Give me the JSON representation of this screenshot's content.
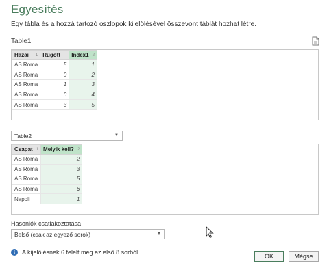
{
  "dialog": {
    "title": "Egyesítés",
    "subtitle": "Egy tábla és a hozzá tartozó oszlopok kijelölésével összevont táblát hozhat létre."
  },
  "table1": {
    "name": "Table1",
    "columns": [
      {
        "label": "Hazai",
        "index": "1",
        "selected": false
      },
      {
        "label": "Rúgott",
        "index": "",
        "selected": false
      },
      {
        "label": "Index1",
        "index": "2",
        "selected": true
      }
    ],
    "rows": [
      [
        "AS Roma",
        "5",
        "1"
      ],
      [
        "AS Roma",
        "0",
        "2"
      ],
      [
        "AS Roma",
        "1",
        "3"
      ],
      [
        "AS Roma",
        "0",
        "4"
      ],
      [
        "AS Roma",
        "3",
        "5"
      ]
    ]
  },
  "table2": {
    "selector_value": "Table2",
    "columns": [
      {
        "label": "Csapat",
        "index": "1",
        "selected": false
      },
      {
        "label": "Melyik kell?",
        "index": "2",
        "selected": true
      }
    ],
    "rows": [
      [
        "AS Roma",
        "2"
      ],
      [
        "AS Roma",
        "3"
      ],
      [
        "AS Roma",
        "5"
      ],
      [
        "AS Roma",
        "6"
      ],
      [
        "Napoli",
        "1"
      ]
    ]
  },
  "join": {
    "label": "Hasonlók csatlakoztatása",
    "value": "Belső (csak az egyező sorok)"
  },
  "info": {
    "icon": "info-icon",
    "text": "A kijelölésnek 6 felelt meg az első 8 sorból."
  },
  "buttons": {
    "ok": "OK",
    "cancel": "Mégse"
  },
  "colors": {
    "title": "#4a7d5d",
    "selected_header": "#bfe3c9",
    "selected_cells": "#e8f4ec",
    "info_icon": "#2f6db5"
  }
}
